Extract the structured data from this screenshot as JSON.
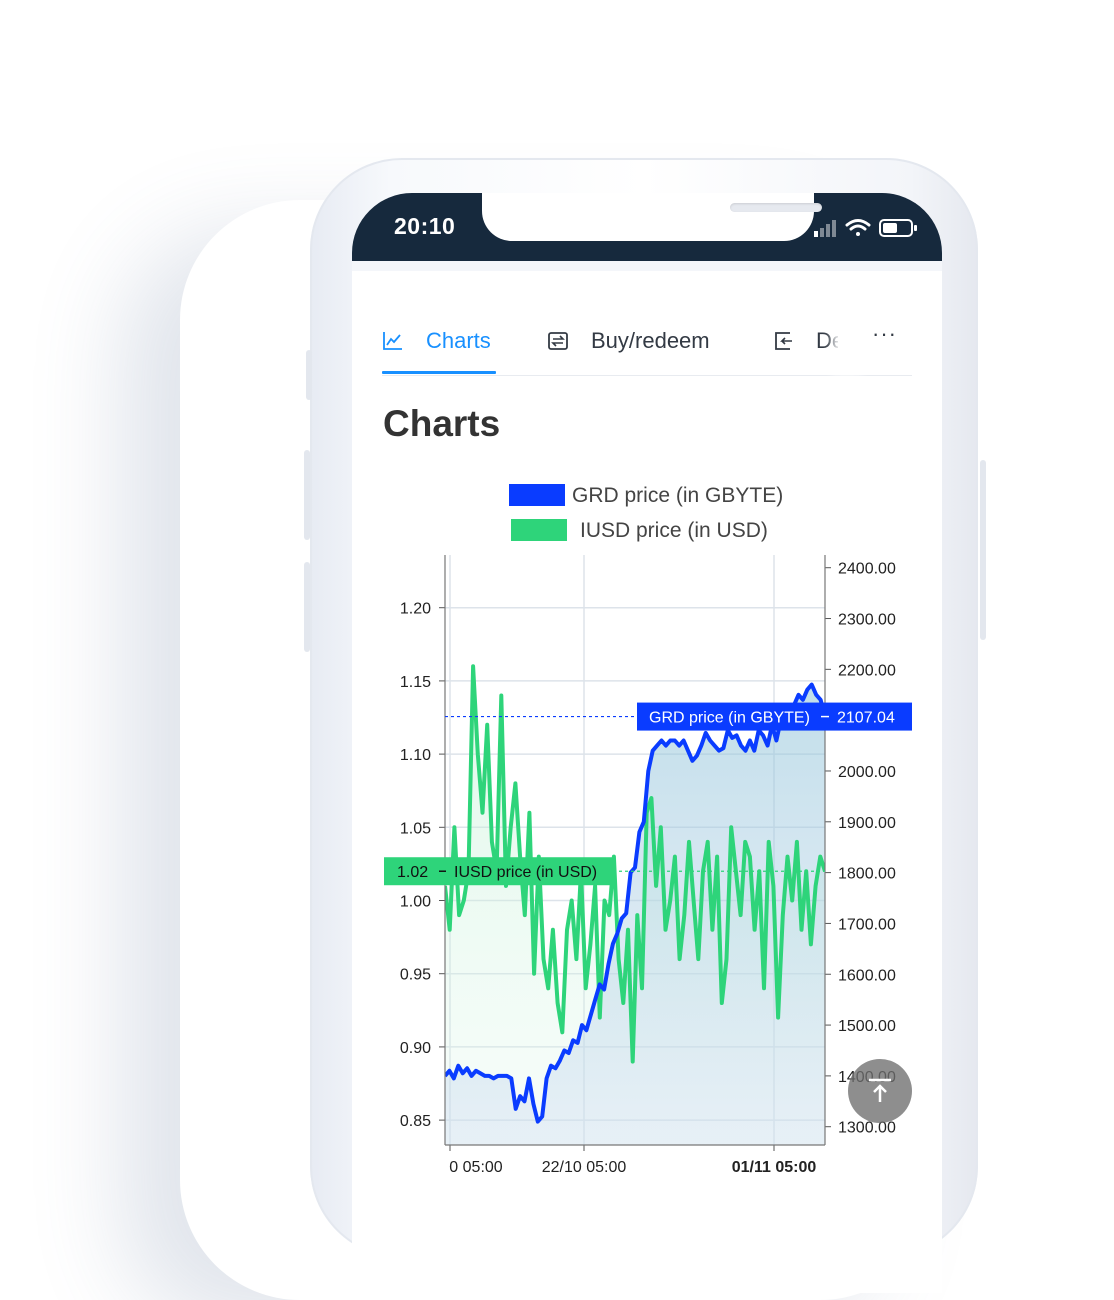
{
  "status_bar": {
    "time": "20:10"
  },
  "tabs": [
    {
      "label": "Charts",
      "icon": "line-chart-icon",
      "active": true
    },
    {
      "label": "Buy/redeem",
      "icon": "swap-icon",
      "active": false
    },
    {
      "label": "De",
      "icon": "deposit-icon",
      "active": false
    }
  ],
  "more_label": "···",
  "page_title": "Charts",
  "colors": {
    "accent": "#1890ff",
    "grd_series": "#0a3cff",
    "iusd_series": "#2ed47a",
    "status_bar": "#16293d"
  },
  "chart_data": {
    "type": "line",
    "legend": [
      "GRD price (in GBYTE)",
      "IUSD price (in USD)"
    ],
    "legend_placement": "top",
    "x_tick_labels": [
      "0 05:00",
      "22/10 05:00",
      "01/11 05:00"
    ],
    "left_axis": {
      "ticks": [
        "1.20",
        "1.15",
        "1.10",
        "1.05",
        "1.00",
        "0.95",
        "0.90",
        "0.85"
      ],
      "range": [
        0.833,
        1.236
      ]
    },
    "right_axis": {
      "ticks": [
        "2400.00",
        "2300.00",
        "2200.00",
        "2100.00",
        "2000.00",
        "1900.00",
        "1800.00",
        "1700.00",
        "1600.00",
        "1500.00",
        "1400.00",
        "1300.00"
      ],
      "range": [
        1264,
        2425
      ]
    },
    "grid": true,
    "series": [
      {
        "name": "GRD price (in GBYTE)",
        "axis": "right",
        "values": [
          1400,
          1410,
          1395,
          1420,
          1405,
          1415,
          1400,
          1410,
          1405,
          1400,
          1400,
          1395,
          1400,
          1400,
          1400,
          1395,
          1335,
          1360,
          1350,
          1395,
          1345,
          1310,
          1320,
          1395,
          1420,
          1415,
          1430,
          1450,
          1445,
          1470,
          1465,
          1500,
          1490,
          1520,
          1550,
          1580,
          1570,
          1620,
          1660,
          1680,
          1710,
          1720,
          1800,
          1810,
          1880,
          1900,
          2000,
          2040,
          2050,
          2060,
          2050,
          2060,
          2060,
          2050,
          2060,
          2040,
          2020,
          2030,
          2050,
          2075,
          2060,
          2050,
          2040,
          2045,
          2080,
          2065,
          2070,
          2050,
          2040,
          2060,
          2040,
          2080,
          2070,
          2050,
          2090,
          2060,
          2100,
          2110,
          2125,
          2130,
          2150,
          2140,
          2160,
          2170,
          2150,
          2140,
          2107.04
        ]
      },
      {
        "name": "IUSD price (in USD)",
        "axis": "left",
        "values": [
          1.01,
          0.98,
          1.05,
          0.99,
          1.0,
          1.02,
          1.16,
          1.1,
          1.06,
          1.12,
          1.04,
          1.02,
          1.14,
          1.01,
          1.05,
          1.08,
          1.03,
          0.99,
          1.06,
          0.95,
          1.03,
          0.96,
          0.94,
          0.98,
          0.93,
          0.91,
          0.98,
          1.0,
          0.96,
          1.02,
          0.94,
          0.97,
          1.01,
          0.92,
          1.0,
          0.99,
          1.03,
          0.96,
          0.93,
          0.98,
          0.89,
          0.99,
          0.94,
          1.06,
          1.07,
          1.01,
          1.05,
          0.98,
          1.0,
          1.03,
          0.96,
          0.99,
          1.04,
          1.0,
          0.96,
          1.02,
          1.04,
          0.98,
          1.03,
          0.93,
          0.96,
          1.05,
          1.02,
          0.99,
          1.04,
          1.03,
          0.98,
          1.02,
          0.94,
          1.04,
          1.01,
          0.92,
          0.99,
          1.03,
          1.0,
          1.04,
          0.98,
          1.02,
          0.97,
          1.01,
          1.03,
          1.02
        ]
      }
    ],
    "last_value_labels": [
      {
        "series": "GRD price (in GBYTE)",
        "name_label": "GRD price (in GBYTE)",
        "value": "2107.04"
      },
      {
        "series": "IUSD price (in USD)",
        "name_label": "IUSD price (in USD)",
        "value": "1.02"
      }
    ]
  }
}
